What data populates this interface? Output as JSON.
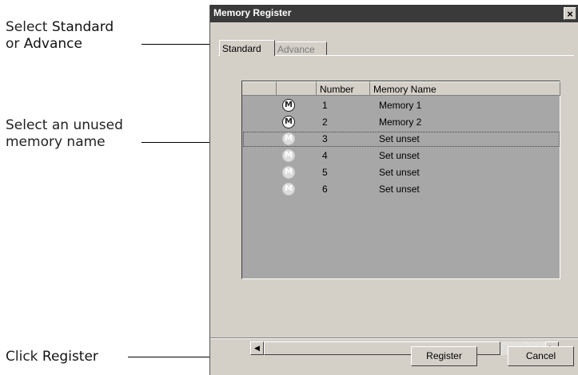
{
  "callouts": {
    "standard": {
      "prefix": "Select ",
      "bold": "Standard",
      "line2_prefix": "or ",
      "line2_bold": "Advance"
    },
    "unused": {
      "line1": "Select an unused",
      "line2": "memory name"
    },
    "register": {
      "prefix": "Click ",
      "bold": "Register"
    }
  },
  "dialog": {
    "title": "Memory Register",
    "close_glyph": "×",
    "tabs": [
      {
        "label": "Standard",
        "active": true
      },
      {
        "label": "Advance",
        "active": false
      }
    ],
    "list": {
      "columns": [
        "",
        "",
        "Number",
        "Memory Name"
      ],
      "rows": [
        {
          "icon": "M",
          "used": true,
          "number": "1",
          "name": "Memory 1"
        },
        {
          "icon": "M",
          "used": true,
          "number": "2",
          "name": "Memory 2"
        },
        {
          "icon": "M",
          "used": false,
          "number": "3",
          "name": "Set unset",
          "focused": true
        },
        {
          "icon": "M",
          "used": false,
          "number": "4",
          "name": "Set unset"
        },
        {
          "icon": "M",
          "used": false,
          "number": "5",
          "name": "Set unset"
        },
        {
          "icon": "M",
          "used": false,
          "number": "6",
          "name": "Set unset"
        }
      ],
      "scroll_left_glyph": "◀",
      "scroll_right_glyph": "▶"
    },
    "buttons": {
      "register": "Register",
      "cancel": "Cancel"
    }
  }
}
